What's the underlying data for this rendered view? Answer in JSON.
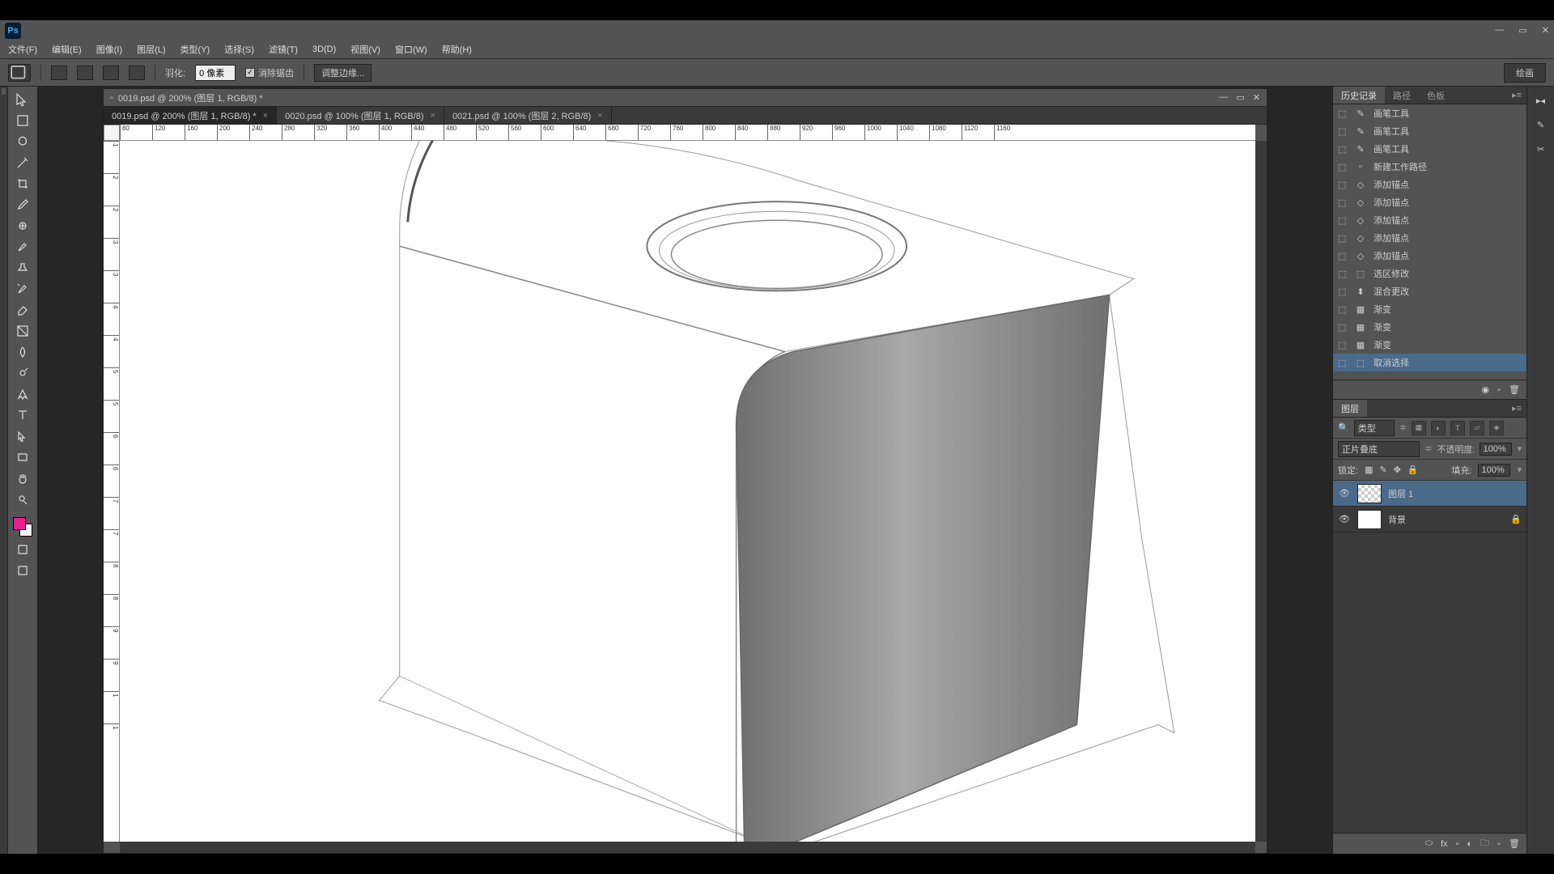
{
  "menubar": [
    "文件(F)",
    "编辑(E)",
    "图像(I)",
    "图层(L)",
    "类型(Y)",
    "选择(S)",
    "滤镜(T)",
    "3D(D)",
    "视图(V)",
    "窗口(W)",
    "帮助(H)"
  ],
  "options": {
    "feather_label": "羽化:",
    "feather_value": "0 像素",
    "antialias": "消除锯齿",
    "refine": "调整边缘..."
  },
  "workspace": "绘画",
  "doc": {
    "title": "0019.psd @ 200% (图层 1, RGB/8) *",
    "tabs": [
      {
        "label": "0019.psd @ 200% (图层 1, RGB/8) *",
        "active": true
      },
      {
        "label": "0020.psd @ 100% (图层 1, RGB/8)",
        "active": false
      },
      {
        "label": "0021.psd @ 100% (图层 2, RGB/8)",
        "active": false
      }
    ]
  },
  "ruler_h": [
    "80",
    "120",
    "160",
    "200",
    "240",
    "280",
    "320",
    "360",
    "400",
    "440",
    "480",
    "520",
    "560",
    "600",
    "640",
    "680",
    "720",
    "760",
    "800",
    "840",
    "880",
    "920",
    "960",
    "1000",
    "1040",
    "1080",
    "1120",
    "1160"
  ],
  "ruler_v": [
    "1",
    "2",
    "2",
    "3",
    "3",
    "4",
    "4",
    "5",
    "5",
    "6",
    "6",
    "7",
    "7",
    "8",
    "8",
    "9",
    "9",
    "1",
    "1"
  ],
  "history": {
    "tabs": [
      "历史记录",
      "路径",
      "色板"
    ],
    "items": [
      {
        "icon": "pencil",
        "label": "画笔工具"
      },
      {
        "icon": "pencil",
        "label": "画笔工具"
      },
      {
        "icon": "pencil",
        "label": "画笔工具"
      },
      {
        "icon": "doc",
        "label": "新建工作路径"
      },
      {
        "icon": "anchor",
        "label": "添加锚点"
      },
      {
        "icon": "anchor",
        "label": "添加锚点"
      },
      {
        "icon": "anchor",
        "label": "添加锚点"
      },
      {
        "icon": "anchor",
        "label": "添加锚点"
      },
      {
        "icon": "anchor",
        "label": "添加锚点"
      },
      {
        "icon": "select",
        "label": "选区修改"
      },
      {
        "icon": "merge",
        "label": "混合更改"
      },
      {
        "icon": "grad",
        "label": "渐变"
      },
      {
        "icon": "grad",
        "label": "渐变"
      },
      {
        "icon": "grad",
        "label": "渐变"
      },
      {
        "icon": "desel",
        "label": "取消选择",
        "selected": true
      }
    ]
  },
  "layers": {
    "tab": "图层",
    "filter_kind": "类型",
    "blend_mode": "正片叠底",
    "opacity_label": "不透明度:",
    "opacity": "100%",
    "lock_label": "锁定:",
    "fill_label": "填充:",
    "fill": "100%",
    "items": [
      {
        "name": "图层 1",
        "selected": true,
        "trans": true,
        "locked": false
      },
      {
        "name": "背景",
        "selected": false,
        "trans": false,
        "locked": true
      }
    ]
  }
}
